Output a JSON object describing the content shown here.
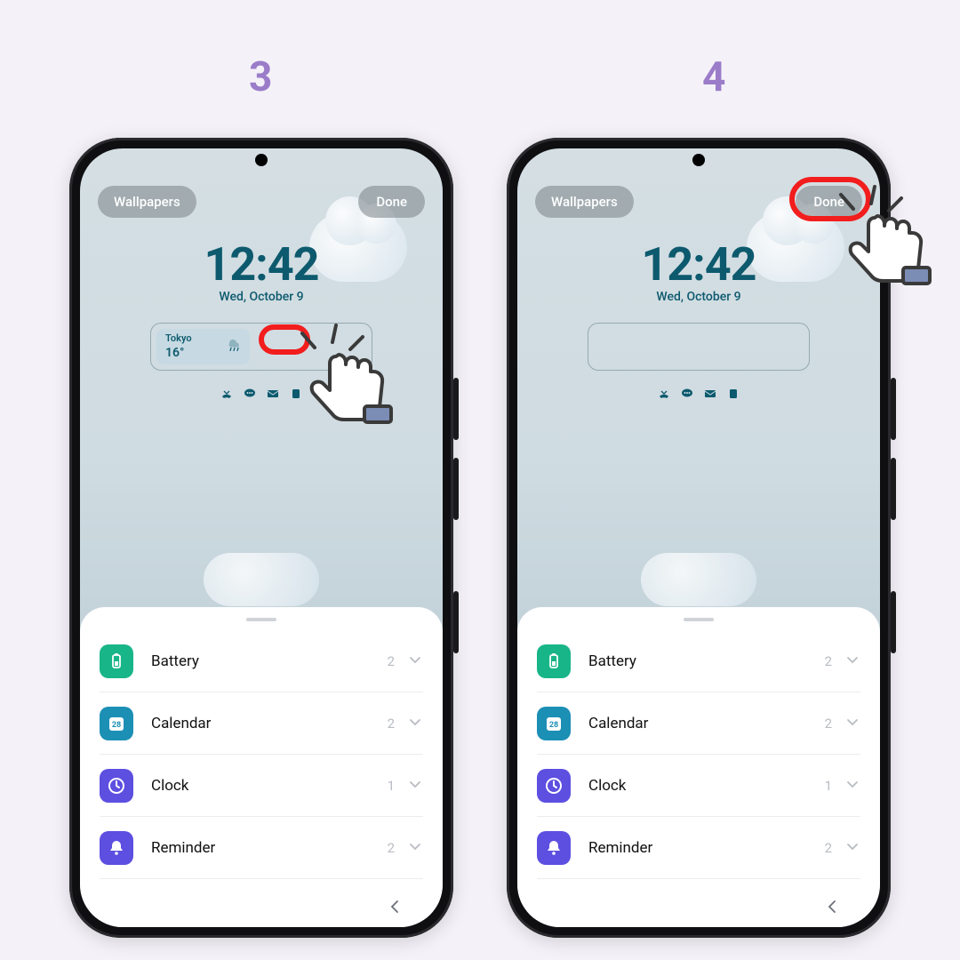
{
  "steps": {
    "left": "3",
    "right": "4"
  },
  "buttons": {
    "wallpapers": "Wallpapers",
    "done": "Done"
  },
  "clock": {
    "time": "12:42",
    "date": "Wed, October 9"
  },
  "weather": {
    "city": "Tokyo",
    "temp": "16°"
  },
  "apps": [
    {
      "name": "Battery",
      "count": "2",
      "color": "#18b588",
      "icon": "battery"
    },
    {
      "name": "Calendar",
      "count": "2",
      "color": "#1c8fb5",
      "icon": "calendar",
      "day": "28"
    },
    {
      "name": "Clock",
      "count": "1",
      "color": "#5d4fe0",
      "icon": "clock"
    },
    {
      "name": "Reminder",
      "count": "2",
      "color": "#5d4fe0",
      "icon": "bell"
    }
  ]
}
